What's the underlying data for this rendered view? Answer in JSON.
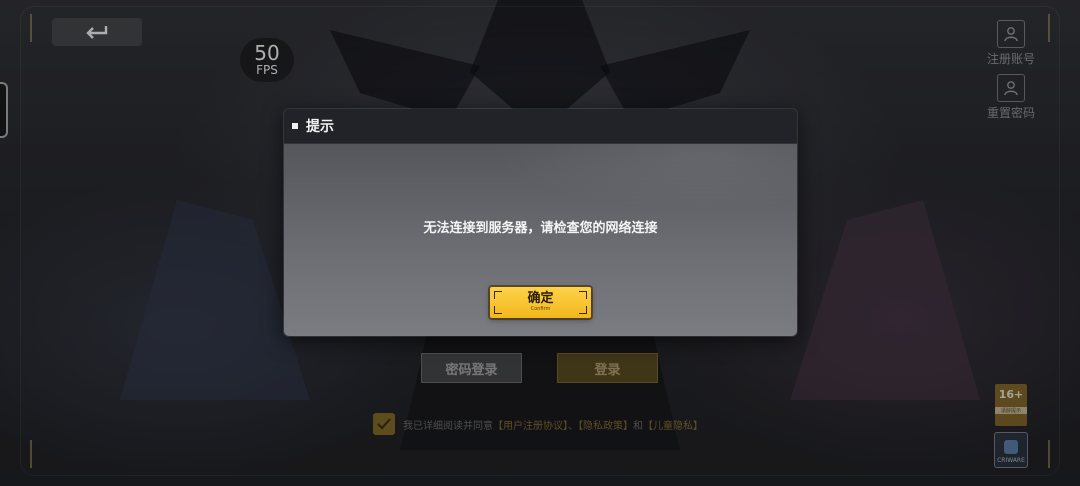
{
  "fps": {
    "value": "50",
    "label": "FPS"
  },
  "side_actions": {
    "register": "注册账号",
    "reset_password": "重置密码"
  },
  "dialog": {
    "title": "提示",
    "message": "无法连接到服务器，请检查您的网络连接",
    "confirm_label": "确定",
    "confirm_sub": "Confirm"
  },
  "login": {
    "password_login": "密码登录",
    "login": "登录"
  },
  "agreement": {
    "prefix": "我已详细阅读并同意",
    "user_agreement": "【用户注册协议】",
    "sep1": "、",
    "privacy_policy": "【隐私政策】",
    "sep2": "和",
    "child_privacy": "【儿童隐私】"
  },
  "rating": {
    "age": "16+",
    "note": "适龄提示"
  },
  "criware": {
    "label": "CRIWARE"
  },
  "colors": {
    "accent": "#f2b81d",
    "dialog_header": "#222329"
  }
}
